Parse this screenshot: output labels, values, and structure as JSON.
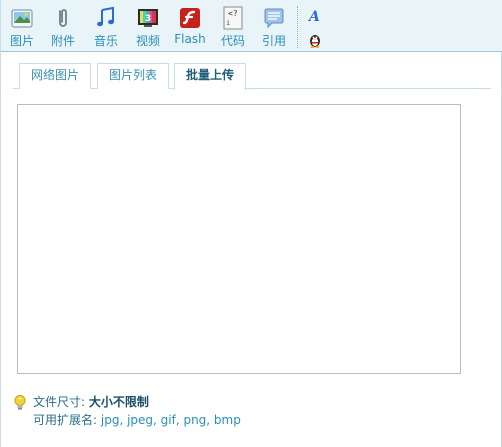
{
  "toolbar": {
    "buttons": [
      {
        "label": "图片",
        "icon": "image-icon"
      },
      {
        "label": "附件",
        "icon": "paperclip-icon"
      },
      {
        "label": "音乐",
        "icon": "music-icon"
      },
      {
        "label": "视频",
        "icon": "video-icon"
      },
      {
        "label": "Flash",
        "icon": "flash-icon"
      },
      {
        "label": "代码",
        "icon": "code-icon"
      },
      {
        "label": "引用",
        "icon": "quote-icon"
      }
    ],
    "font_icon": "font-style-icon",
    "qq_icon": "qq-penguin-icon"
  },
  "tabs": [
    {
      "label": "网络图片",
      "active": false
    },
    {
      "label": "图片列表",
      "active": false
    },
    {
      "label": "批量上传",
      "active": true
    }
  ],
  "info": {
    "size_label": "文件尺寸:",
    "size_value": "大小不限制",
    "ext_label": "可用扩展名:",
    "ext_value": "jpg, jpeg, gif, png, bmp"
  },
  "colors": {
    "toolbar_bg": "#e9f4f9",
    "label_blue": "#2a8fb8",
    "border": "#c9dde6"
  }
}
